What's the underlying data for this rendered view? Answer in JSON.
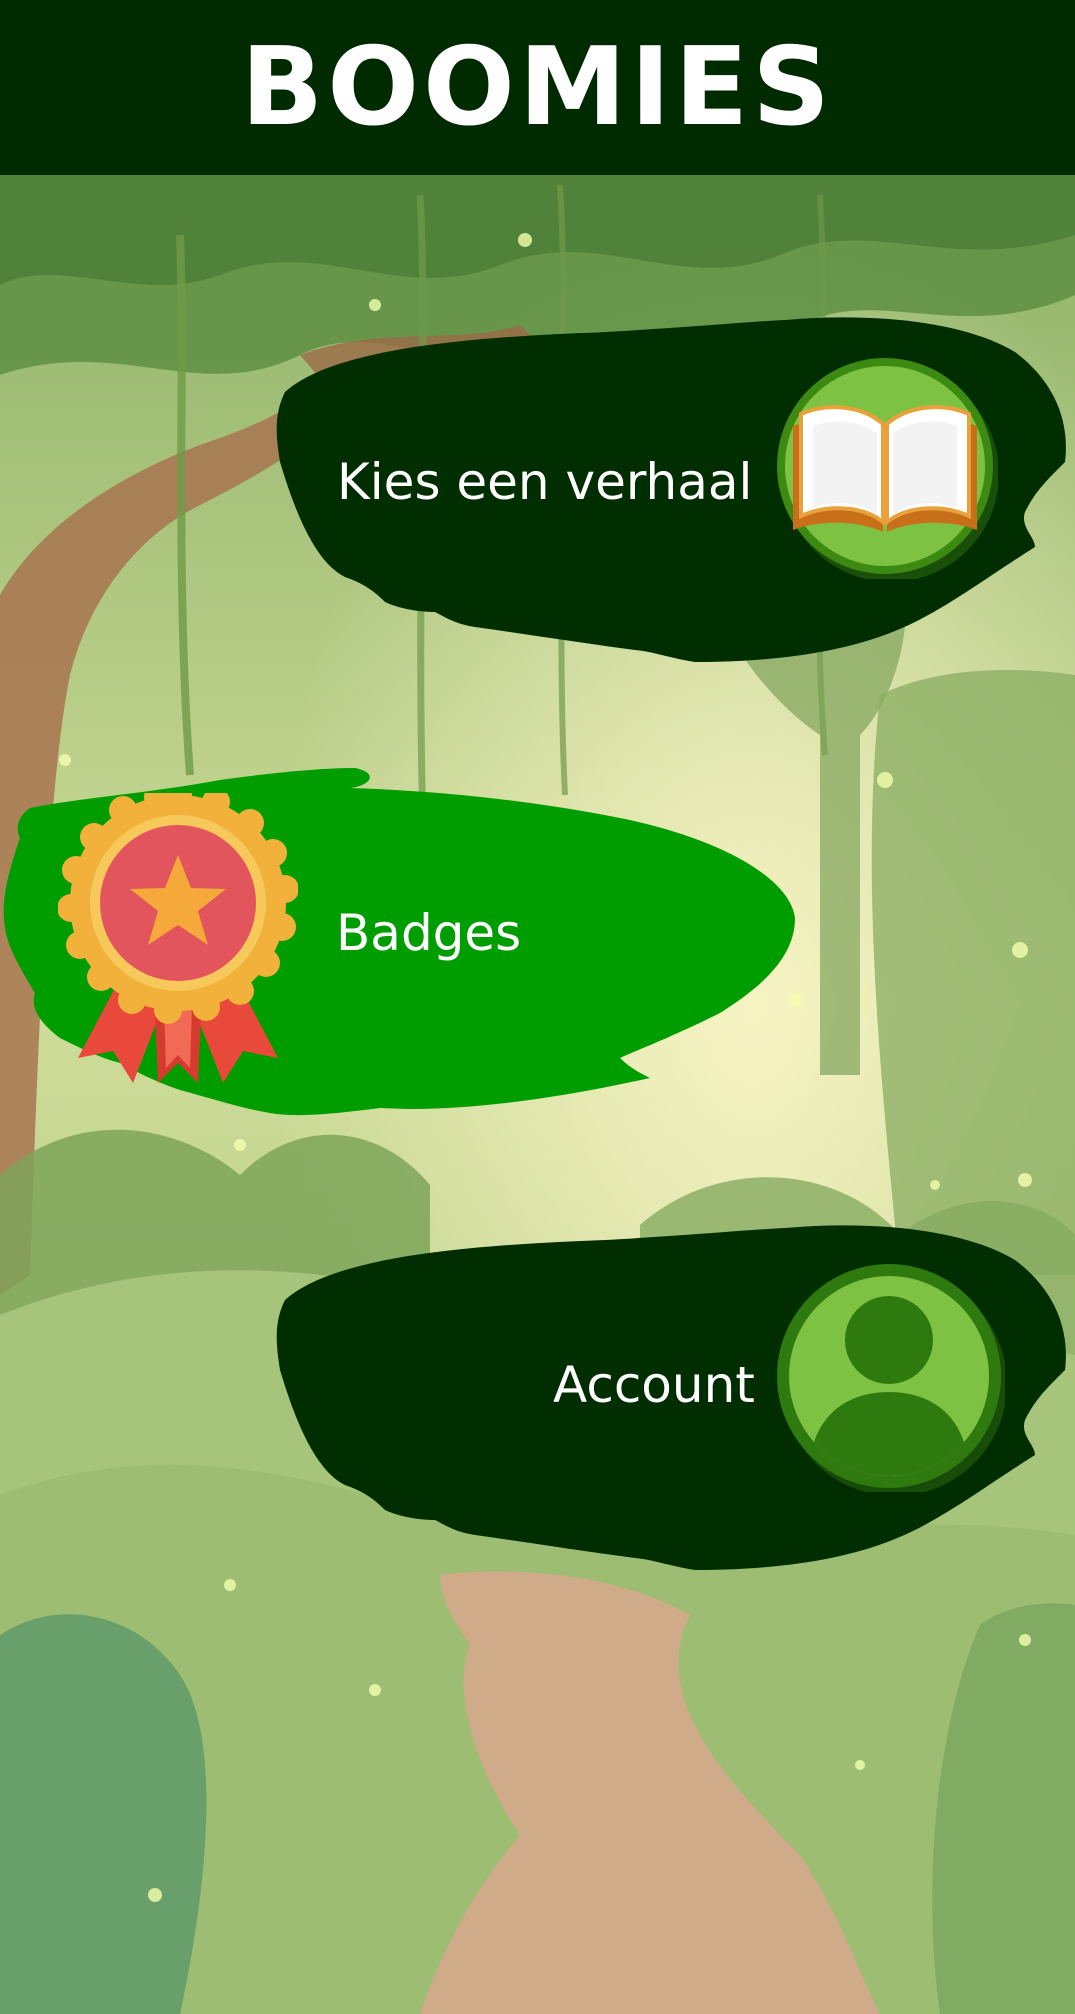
{
  "header": {
    "title": "BOOMIES"
  },
  "menu": {
    "stories": {
      "label": "Kies een verhaal",
      "icon": "book-icon"
    },
    "badges": {
      "label": "Badges",
      "icon": "badge-ribbon-icon"
    },
    "account": {
      "label": "Account",
      "icon": "account-user-icon"
    }
  },
  "colors": {
    "header_bg": "#002a00",
    "dark_leaf": "#002e00",
    "bright_leaf": "#009d00",
    "icon_circle": "#7dc242",
    "icon_circle_dark": "#3d8a12",
    "text": "#ffffff"
  }
}
